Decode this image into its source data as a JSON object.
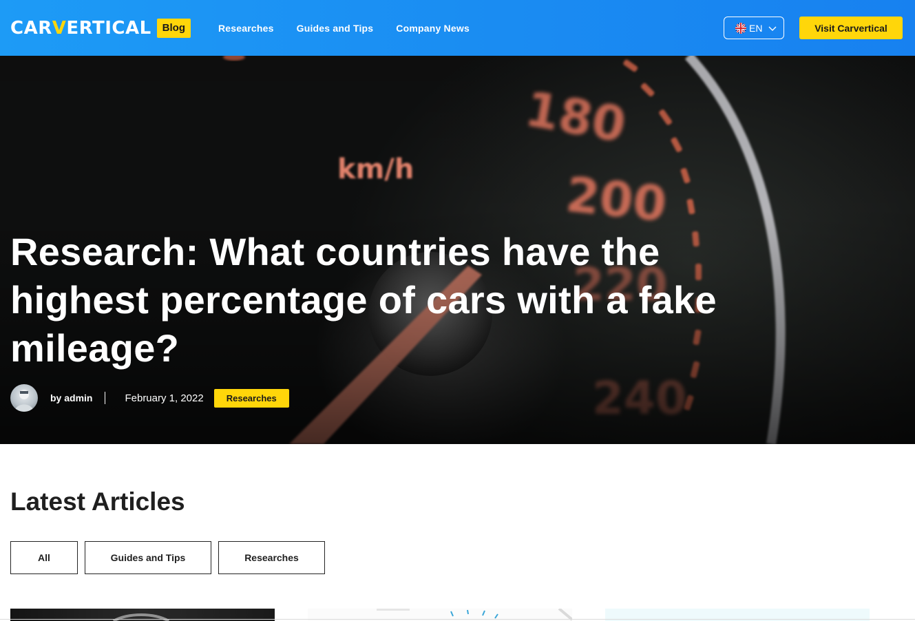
{
  "header": {
    "logo_text_before": "CAR",
    "logo_text_v": "V",
    "logo_text_after": "ERTICAL",
    "logo_badge": "Blog",
    "nav": [
      {
        "label": "Researches"
      },
      {
        "label": "Guides and Tips"
      },
      {
        "label": "Company News"
      }
    ],
    "language": {
      "code": "EN",
      "flag": "uk-flag-icon"
    },
    "cta_label": "Visit Carvertical",
    "colors": {
      "header_bg": "#1a8cf2",
      "accent": "#ffd60a"
    }
  },
  "hero": {
    "title": "Research: What countries have the highest percentage of cars with a fake mileage?",
    "author": "by admin",
    "date": "February 1, 2022",
    "category": "Researches",
    "speedometer_labels": [
      "km/h",
      "180",
      "200",
      "220",
      "240"
    ]
  },
  "latest": {
    "title": "Latest Articles",
    "filters": [
      {
        "label": "All"
      },
      {
        "label": "Guides and Tips"
      },
      {
        "label": "Researches"
      }
    ]
  }
}
